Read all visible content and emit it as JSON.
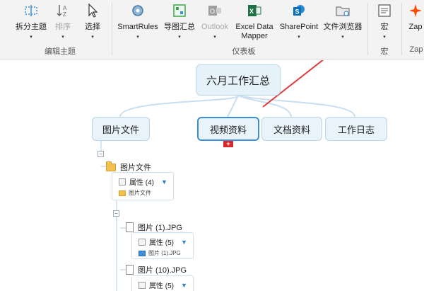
{
  "ribbon": {
    "groups": [
      {
        "label": "编辑主题",
        "buttons": [
          {
            "label": "拆分主题",
            "icon": "split-topic-icon",
            "caret": "▾"
          },
          {
            "label": "排序",
            "icon": "sort-icon",
            "caret": "▾",
            "disabled": true
          },
          {
            "label": "选择",
            "icon": "select-cursor-icon",
            "caret": "▾"
          }
        ]
      },
      {
        "label": "仪表板",
        "buttons": [
          {
            "label": "SmartRules",
            "icon": "smartrules-gear-icon",
            "caret": "▾"
          },
          {
            "label": "导图汇总",
            "icon": "map-summary-icon",
            "caret": "▾"
          },
          {
            "label": "Outlook",
            "icon": "outlook-icon",
            "caret": "▾",
            "disabled": true
          },
          {
            "label": "Excel Data Mapper",
            "icon": "excel-icon"
          },
          {
            "label": "SharePoint",
            "icon": "sharepoint-icon",
            "caret": "▾"
          },
          {
            "label": "文件浏览器",
            "icon": "file-browser-icon",
            "caret": "▾"
          }
        ]
      },
      {
        "label": "宏",
        "buttons": [
          {
            "label": "宏",
            "icon": "macro-icon",
            "caret": "▾"
          }
        ]
      },
      {
        "label": "Zap",
        "buttons": [
          {
            "label": "Zap",
            "icon": "zapier-icon"
          }
        ]
      }
    ],
    "colors": {
      "excel": "#1e7145",
      "sharepoint": "#0b6fb5",
      "outlook": "#9e9e9e",
      "zap": "#ff4a00",
      "arrow": "#e03b3b"
    }
  },
  "map": {
    "root": "六月工作汇总",
    "children": [
      {
        "label": "图片文件"
      },
      {
        "label": "视频资料",
        "selected": true
      },
      {
        "label": "文档资料"
      },
      {
        "label": "工作日志"
      }
    ],
    "expand_badge": "+",
    "collapse_glyph": "−",
    "tree": {
      "folder": {
        "label": "图片文件",
        "prop_label": "属性 (4)",
        "sub_label": "图片文件"
      },
      "files": [
        {
          "label": "图片 (1).JPG",
          "prop_label": "属性 (5)",
          "sub_label": "图片 (1).JPG"
        },
        {
          "label": "图片 (10).JPG",
          "prop_label": "属性 (5)"
        }
      ]
    }
  }
}
